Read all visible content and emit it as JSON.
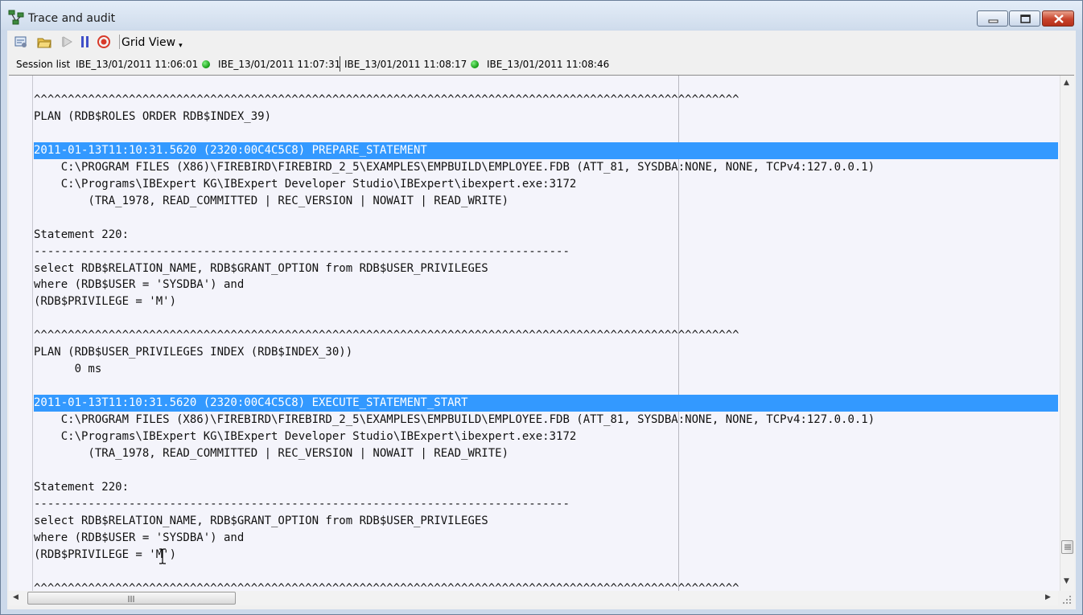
{
  "window": {
    "title": "Trace and audit"
  },
  "toolbar": {
    "view_label": "Grid View",
    "view_arrow": "▾",
    "icons": [
      "settings-icon",
      "open-folder-icon",
      "play-icon",
      "pause-icon",
      "stop-icon"
    ]
  },
  "sessions": {
    "label": "Session list",
    "items": [
      {
        "name": "IBE_13/01/2011 11:06:01",
        "active": true
      },
      {
        "name": "IBE_13/01/2011 11:07:31",
        "active": false
      },
      {
        "name": "IBE_13/01/2011 11:08:17",
        "active": true
      },
      {
        "name": "IBE_13/01/2011 11:08:46",
        "active": false
      }
    ]
  },
  "trace": {
    "lines": [
      {
        "text": "^^^^^^^^^^^^^^^^^^^^^^^^^^^^^^^^^^^^^^^^^^^^^^^^^^^^^^^^^^^^^^^^^^^^^^^^^^^^^^^^^^^^^^^^^^^^^^^^^^^^^^^^",
        "hl": false
      },
      {
        "text": "PLAN (RDB$ROLES ORDER RDB$INDEX_39)",
        "hl": false
      },
      {
        "text": "",
        "hl": false
      },
      {
        "text": "2011-01-13T11:10:31.5620 (2320:00C4C5C8) PREPARE_STATEMENT",
        "hl": true
      },
      {
        "text": "    C:\\PROGRAM FILES (X86)\\FIREBIRD\\FIREBIRD_2_5\\EXAMPLES\\EMPBUILD\\EMPLOYEE.FDB (ATT_81, SYSDBA:NONE, NONE, TCPv4:127.0.0.1)",
        "hl": false
      },
      {
        "text": "    C:\\Programs\\IBExpert KG\\IBExpert Developer Studio\\IBExpert\\ibexpert.exe:3172",
        "hl": false
      },
      {
        "text": "        (TRA_1978, READ_COMMITTED | REC_VERSION | NOWAIT | READ_WRITE)",
        "hl": false
      },
      {
        "text": "",
        "hl": false
      },
      {
        "text": "Statement 220:",
        "hl": false
      },
      {
        "text": "-------------------------------------------------------------------------------",
        "hl": false
      },
      {
        "text": "select RDB$RELATION_NAME, RDB$GRANT_OPTION from RDB$USER_PRIVILEGES",
        "hl": false
      },
      {
        "text": "where (RDB$USER = 'SYSDBA') and",
        "hl": false
      },
      {
        "text": "(RDB$PRIVILEGE = 'M')",
        "hl": false
      },
      {
        "text": "",
        "hl": false
      },
      {
        "text": "^^^^^^^^^^^^^^^^^^^^^^^^^^^^^^^^^^^^^^^^^^^^^^^^^^^^^^^^^^^^^^^^^^^^^^^^^^^^^^^^^^^^^^^^^^^^^^^^^^^^^^^^",
        "hl": false
      },
      {
        "text": "PLAN (RDB$USER_PRIVILEGES INDEX (RDB$INDEX_30))",
        "hl": false
      },
      {
        "text": "      0 ms",
        "hl": false
      },
      {
        "text": "",
        "hl": false
      },
      {
        "text": "2011-01-13T11:10:31.5620 (2320:00C4C5C8) EXECUTE_STATEMENT_START",
        "hl": true
      },
      {
        "text": "    C:\\PROGRAM FILES (X86)\\FIREBIRD\\FIREBIRD_2_5\\EXAMPLES\\EMPBUILD\\EMPLOYEE.FDB (ATT_81, SYSDBA:NONE, NONE, TCPv4:127.0.0.1)",
        "hl": false
      },
      {
        "text": "    C:\\Programs\\IBExpert KG\\IBExpert Developer Studio\\IBExpert\\ibexpert.exe:3172",
        "hl": false
      },
      {
        "text": "        (TRA_1978, READ_COMMITTED | REC_VERSION | NOWAIT | READ_WRITE)",
        "hl": false
      },
      {
        "text": "",
        "hl": false
      },
      {
        "text": "Statement 220:",
        "hl": false
      },
      {
        "text": "-------------------------------------------------------------------------------",
        "hl": false
      },
      {
        "text": "select RDB$RELATION_NAME, RDB$GRANT_OPTION from RDB$USER_PRIVILEGES",
        "hl": false
      },
      {
        "text": "where (RDB$USER = 'SYSDBA') and",
        "hl": false
      },
      {
        "text": "(RDB$PRIVILEGE = 'M')",
        "hl": false
      },
      {
        "text": "",
        "hl": false
      },
      {
        "text": "^^^^^^^^^^^^^^^^^^^^^^^^^^^^^^^^^^^^^^^^^^^^^^^^^^^^^^^^^^^^^^^^^^^^^^^^^^^^^^^^^^^^^^^^^^^^^^^^^^^^^^^^",
        "hl": false
      }
    ]
  },
  "scrollbars": {
    "up": "▲",
    "down": "▼",
    "left": "◀",
    "right": "▶"
  }
}
